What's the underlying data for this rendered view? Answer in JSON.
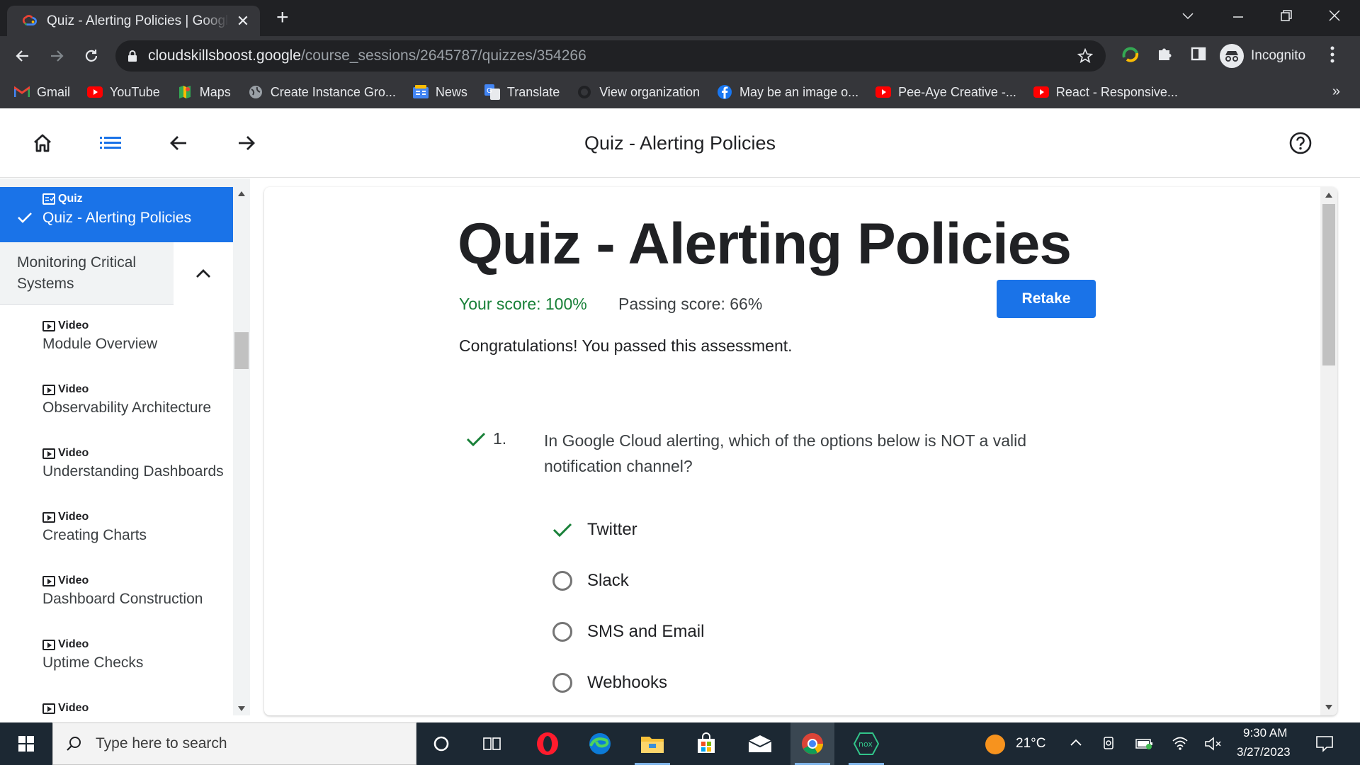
{
  "browser": {
    "tab_title": "Quiz - Alerting Policies | Google Cloud Skills Boost",
    "url_domain": "cloudskillsboost.google",
    "url_path": "/course_sessions/2645787/quizzes/354266",
    "profile_label": "Incognito"
  },
  "bookmarks": [
    {
      "label": "Gmail",
      "icon": "gmail-icon"
    },
    {
      "label": "YouTube",
      "icon": "youtube-icon"
    },
    {
      "label": "Maps",
      "icon": "maps-icon"
    },
    {
      "label": "Create Instance Gro...",
      "icon": "globe-icon"
    },
    {
      "label": "News",
      "icon": "news-icon"
    },
    {
      "label": "Translate",
      "icon": "translate-icon"
    },
    {
      "label": "View organization",
      "icon": "github-icon"
    },
    {
      "label": "May be an image o...",
      "icon": "facebook-icon"
    },
    {
      "label": "Pee-Aye Creative -...",
      "icon": "youtube-icon"
    },
    {
      "label": "React - Responsive...",
      "icon": "youtube-icon"
    }
  ],
  "header": {
    "title": "Quiz - Alerting Policies"
  },
  "sidebar": {
    "active": {
      "kind": "Quiz",
      "title": "Quiz - Alerting Policies"
    },
    "section_title": "Monitoring Critical Systems",
    "items": [
      {
        "kind": "Video",
        "title": "Module Overview"
      },
      {
        "kind": "Video",
        "title": "Observability Architecture"
      },
      {
        "kind": "Video",
        "title": "Understanding Dashboards"
      },
      {
        "kind": "Video",
        "title": "Creating Charts"
      },
      {
        "kind": "Video",
        "title": "Dashboard Construction"
      },
      {
        "kind": "Video",
        "title": "Uptime Checks"
      },
      {
        "kind": "Video",
        "title": ""
      }
    ]
  },
  "quiz": {
    "title": "Quiz - Alerting Policies",
    "your_score": "Your score: 100%",
    "passing_score": "Passing score: 66%",
    "retake_label": "Retake",
    "message": "Congratulations! You passed this assessment.",
    "question_number": "1.",
    "question_text": "In Google Cloud alerting, which of the options below is NOT a valid notification channel?",
    "options": [
      {
        "label": "Twitter",
        "selected": true
      },
      {
        "label": "Slack",
        "selected": false
      },
      {
        "label": "SMS and Email",
        "selected": false
      },
      {
        "label": "Webhooks",
        "selected": false
      }
    ]
  },
  "taskbar": {
    "search_placeholder": "Type here to search",
    "temperature": "21°C",
    "time": "9:30 AM",
    "date": "3/27/2023"
  },
  "colors": {
    "accent": "#1a73e8",
    "success": "#188038"
  }
}
